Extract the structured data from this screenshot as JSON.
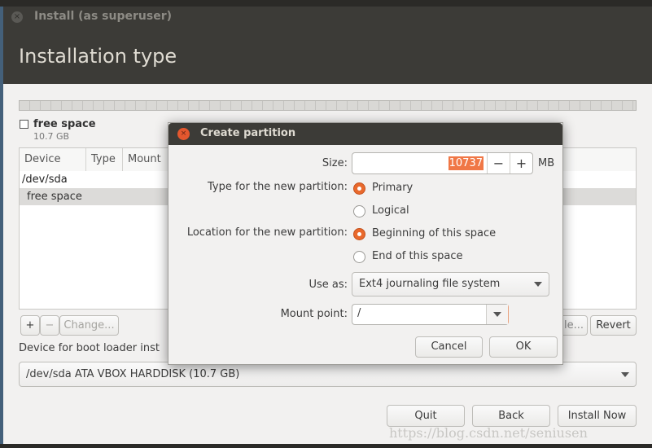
{
  "window": {
    "title": "Install (as superuser)",
    "close_icon": "close-icon"
  },
  "page": {
    "title": "Installation type"
  },
  "disk": {
    "legend_label": "free space",
    "legend_size": "10.7 GB"
  },
  "table": {
    "headers": [
      "Device",
      "Type",
      "Mount"
    ],
    "rows": [
      {
        "device": "/dev/sda"
      },
      {
        "device": "free space",
        "selected": true
      }
    ]
  },
  "table_buttons": {
    "add": "+",
    "remove": "−",
    "change": "Change...",
    "new_table_partial": "le...",
    "revert": "Revert"
  },
  "bootloader": {
    "label": "Device for boot loader inst",
    "value": "/dev/sda ATA VBOX HARDDISK (10.7 GB)"
  },
  "nav": {
    "quit": "Quit",
    "back": "Back",
    "install": "Install Now"
  },
  "watermark": "https://blog.csdn.net/seniusen",
  "dialog": {
    "title": "Create partition",
    "size_label": "Size:",
    "size_value": "10737",
    "size_unit": "MB",
    "minus": "−",
    "plus": "+",
    "type_label": "Type for the new partition:",
    "type_options": [
      "Primary",
      "Logical"
    ],
    "type_selected": "Primary",
    "location_label": "Location for the new partition:",
    "location_options": [
      "Beginning of this space",
      "End of this space"
    ],
    "location_selected": "Beginning of this space",
    "use_as_label": "Use as:",
    "use_as_value": "Ext4 journaling file system",
    "mount_label": "Mount point:",
    "mount_value": "/",
    "cancel": "Cancel",
    "ok": "OK"
  },
  "colors": {
    "accent": "#e9692c",
    "header": "#3c3b37",
    "background": "#f2f1f0"
  }
}
